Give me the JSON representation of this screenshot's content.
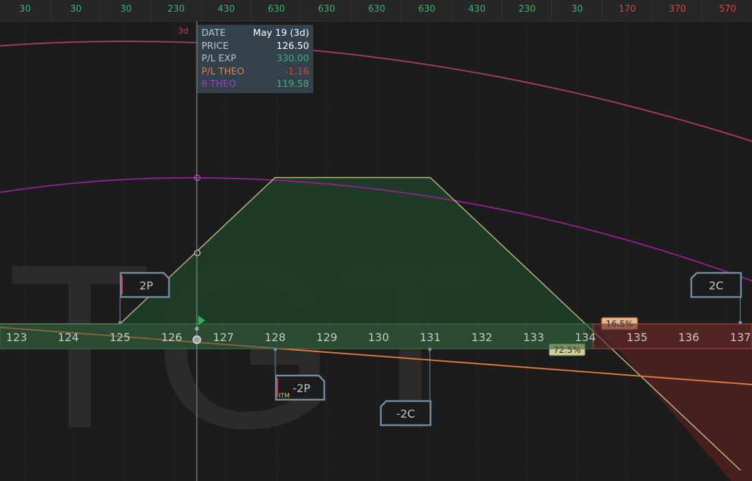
{
  "top_bar": {
    "cells": [
      {
        "text": "30",
        "color": "#3cb371"
      },
      {
        "text": "30",
        "color": "#3cb371"
      },
      {
        "text": "30",
        "color": "#3cb371"
      },
      {
        "text": "230",
        "color": "#3cb371"
      },
      {
        "text": "430",
        "color": "#3cb371"
      },
      {
        "text": "630",
        "color": "#3cb371"
      },
      {
        "text": "630",
        "color": "#3cb371"
      },
      {
        "text": "630",
        "color": "#3cb371"
      },
      {
        "text": "630",
        "color": "#3cb371"
      },
      {
        "text": "430",
        "color": "#3cb371"
      },
      {
        "text": "230",
        "color": "#3cb371"
      },
      {
        "text": "30",
        "color": "#3cb371"
      },
      {
        "text": "170",
        "color": "#e0413e"
      },
      {
        "text": "370",
        "color": "#e0413e"
      },
      {
        "text": "570",
        "color": "#e0413e"
      }
    ]
  },
  "watermark": "TGT",
  "cursor_labels": {
    "left": "3d",
    "right": "3d"
  },
  "tooltip": {
    "date_label": "DATE",
    "date_value": "May 19 (3d)",
    "price_label": "PRICE",
    "price_value": "126.50",
    "pl_exp_label": "P/L EXP",
    "pl_exp_value": "330.00",
    "pl_theo_label": "P/L THEO",
    "pl_theo_value": "-1.16",
    "theta_label": "θ THEO",
    "theta_value": "119.58"
  },
  "chart_data": {
    "type": "line",
    "title": "",
    "xlabel": "",
    "ylabel": "",
    "x_ticks": [
      123,
      124,
      125,
      126,
      127,
      128,
      129,
      130,
      131,
      132,
      133,
      134,
      135,
      136,
      137
    ],
    "xlim": [
      122.5,
      137.2
    ],
    "cursor_price": 126.5,
    "series": [
      {
        "kind": "pl_expiration",
        "points": [
          [
            122.5,
            30
          ],
          [
            125,
            30
          ],
          [
            127,
            430
          ],
          [
            128,
            630
          ],
          [
            131,
            630
          ],
          [
            133,
            230
          ],
          [
            134,
            30
          ],
          [
            137,
            -570
          ]
        ]
      },
      {
        "kind": "theta_curve_upper"
      },
      {
        "kind": "theta_curve_lower"
      },
      {
        "kind": "pl_theo_line"
      }
    ],
    "position_tags": [
      {
        "label": "2P",
        "strike": 125
      },
      {
        "label": "-2P",
        "strike": 128,
        "badge": "ITM"
      },
      {
        "label": "-2C",
        "strike": 131
      },
      {
        "label": "2C",
        "strike": 137
      }
    ],
    "probabilities": [
      {
        "text": "16.5%",
        "side": "loss"
      },
      {
        "text": "72.5%",
        "side": "profit"
      }
    ],
    "colors": {
      "profit_fill": "#1f3d28",
      "loss_fill": "#4a201f",
      "pl_line": "#b8b87a",
      "theo_line": "#e07b39",
      "theta_upper": "#a03a6a",
      "theta_lower": "#8e1f8e",
      "tag_border": "#6f8fa8",
      "green": "#3cb371",
      "red": "#e0413e"
    }
  }
}
